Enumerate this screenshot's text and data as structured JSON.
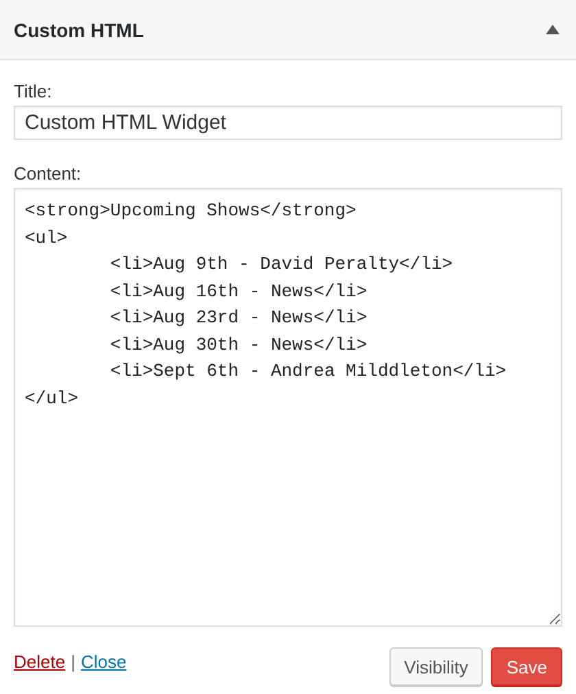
{
  "widget": {
    "title": "Custom HTML",
    "expanded": true
  },
  "title_field": {
    "label": "Title:",
    "value": "Custom HTML Widget"
  },
  "content_field": {
    "label": "Content:",
    "value": "<strong>Upcoming Shows</strong>\n<ul>\n\t<li>Aug 9th - David Peralty</li>\n\t<li>Aug 16th - News</li>\n\t<li>Aug 23rd - News</li>\n\t<li>Aug 30th - News</li>\n\t<li>Sept 6th - Andrea Milddleton</li>\n</ul>"
  },
  "links": [
    "Delete",
    "Close"
  ],
  "separator": "|",
  "buttons": [
    "Visibility",
    "Save"
  ]
}
